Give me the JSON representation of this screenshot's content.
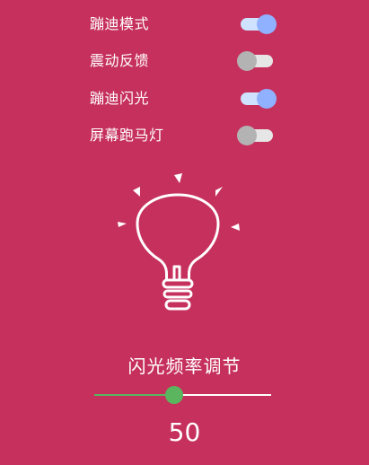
{
  "settings": {
    "items": [
      {
        "label": "蹦迪模式",
        "on": true
      },
      {
        "label": "震动反馈",
        "on": false
      },
      {
        "label": "蹦迪闪光",
        "on": true
      },
      {
        "label": "屏幕跑马灯",
        "on": false
      }
    ]
  },
  "icons": {
    "bulb": "light-bulb-icon"
  },
  "frequency": {
    "title": "闪光频率调节",
    "value": "50",
    "level": 0.45
  },
  "colors": {
    "background": "#c6305d",
    "switch_on_thumb": "#8fb1ff",
    "switch_on_track": "#cfe2ff",
    "switch_off_thumb": "#b3b3b3",
    "switch_off_track": "#e6e6e6",
    "slider_accent": "#5ab55e"
  }
}
